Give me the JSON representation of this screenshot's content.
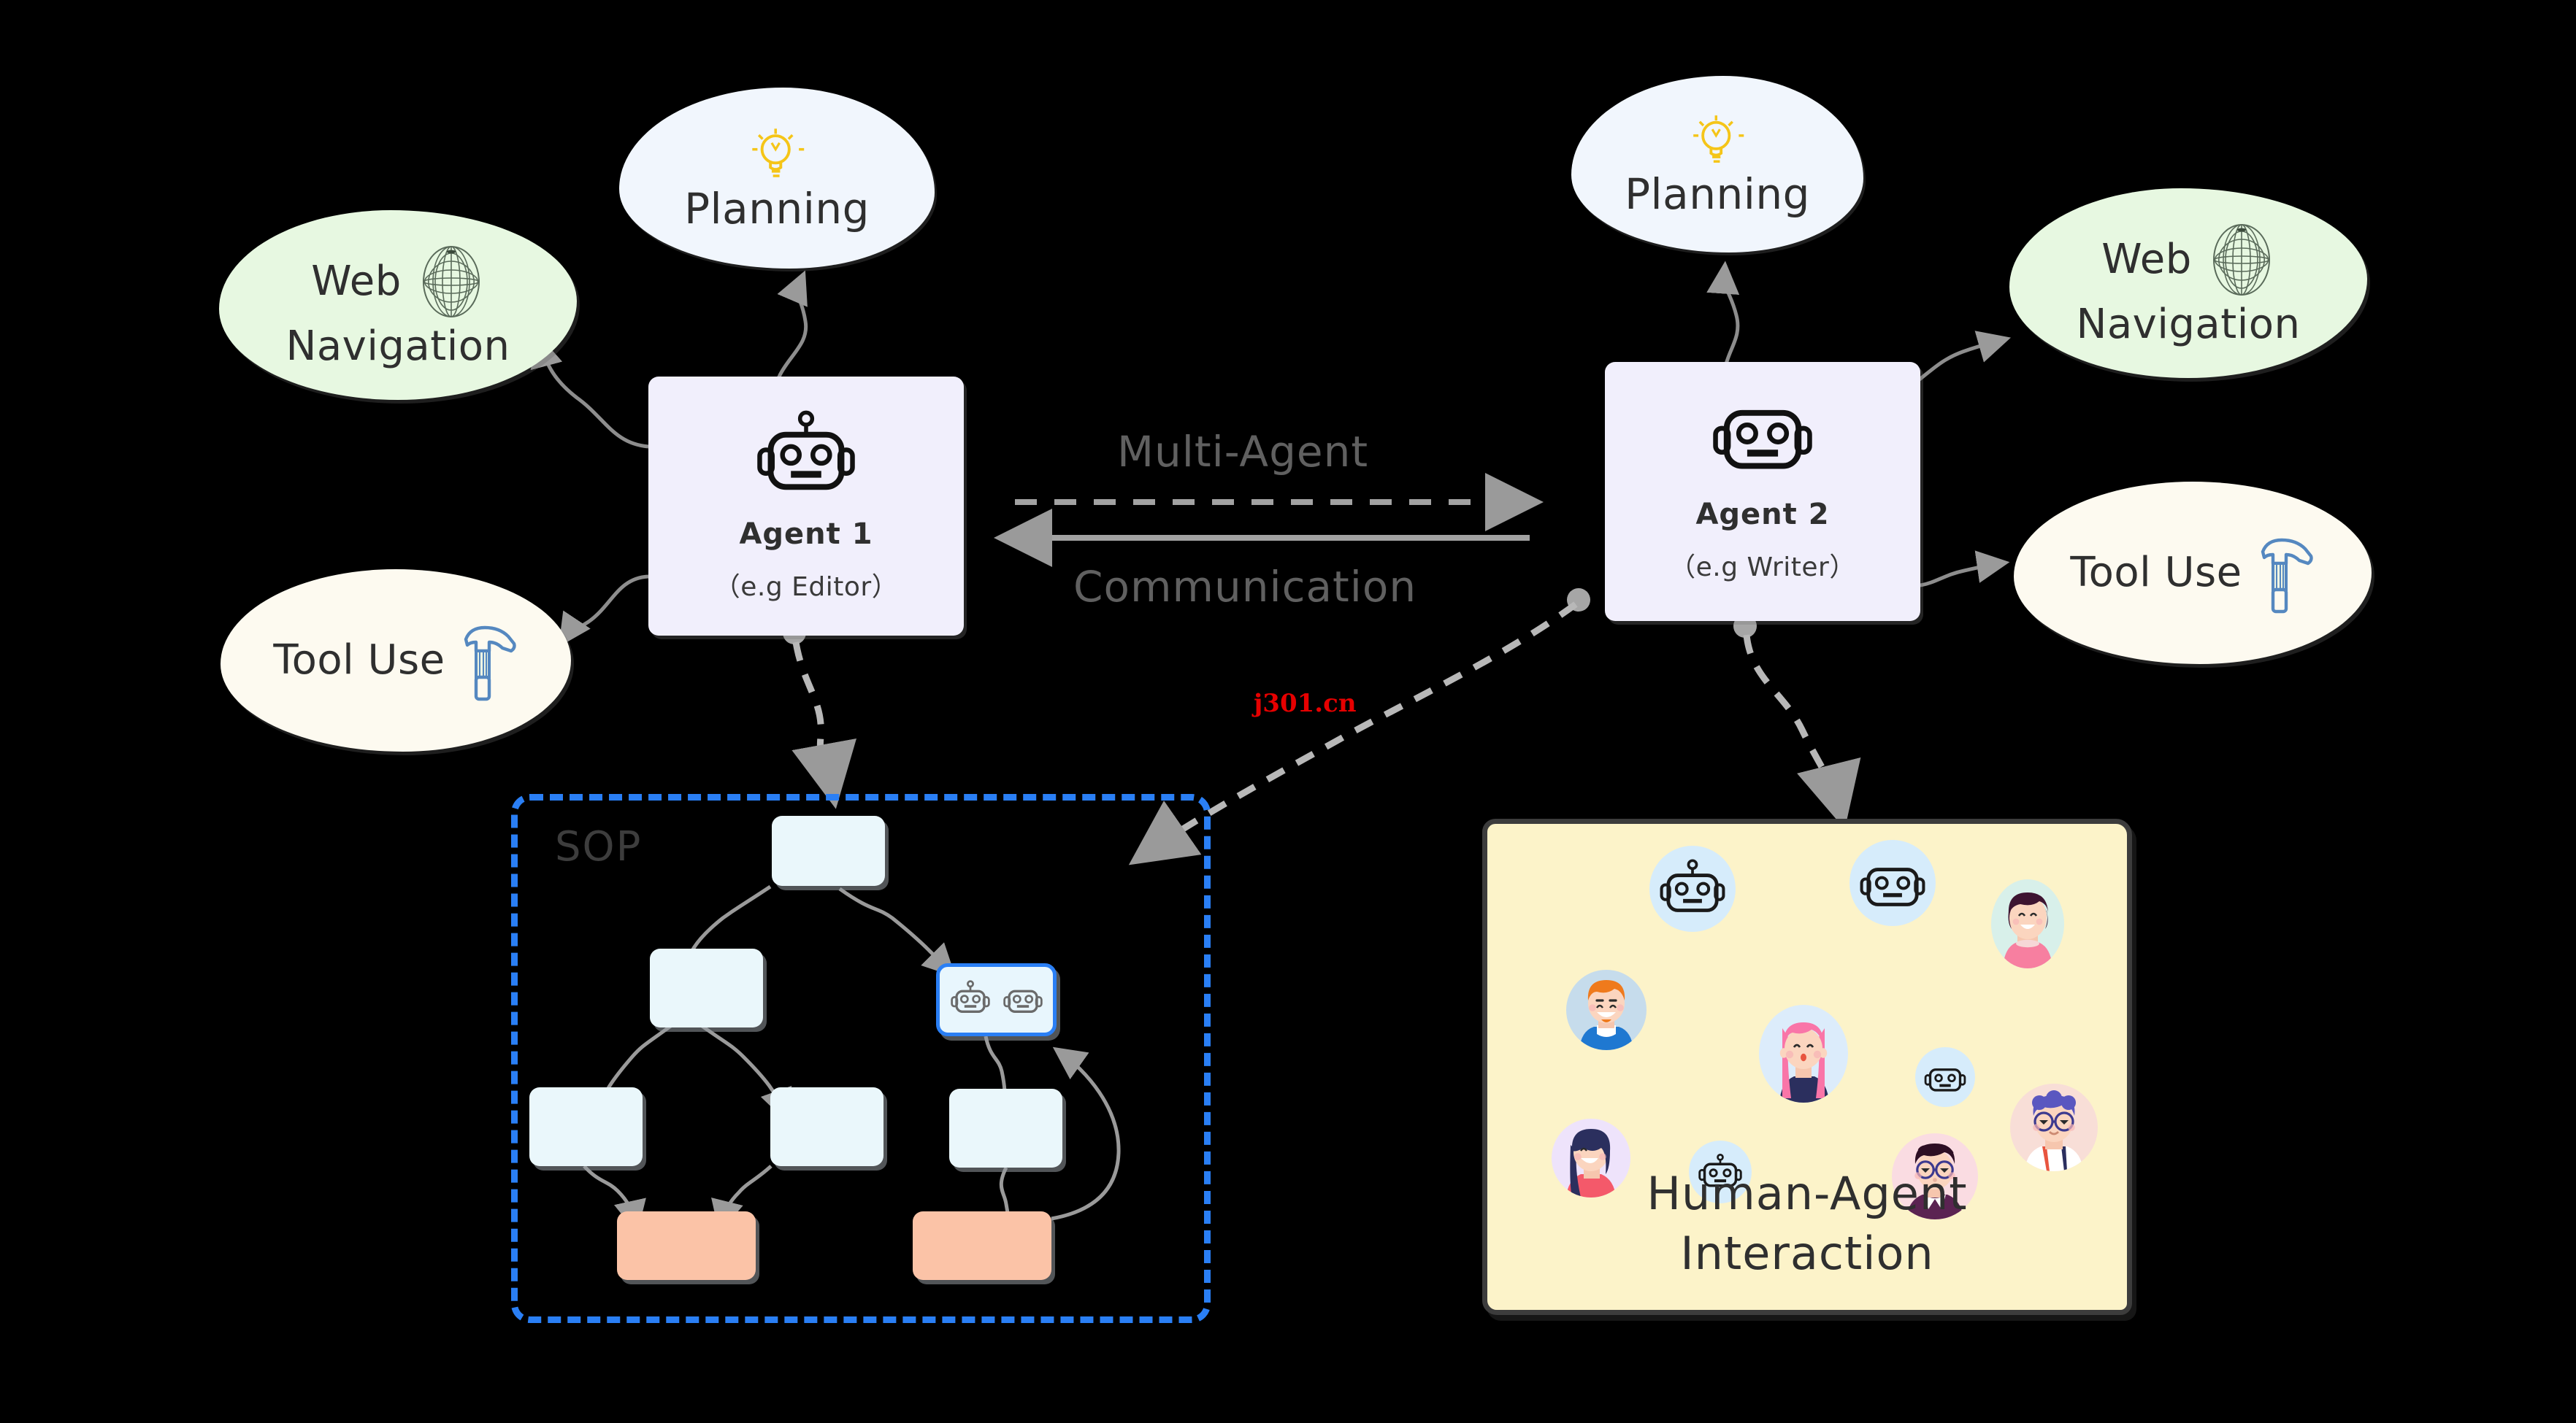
{
  "diagram": {
    "title_watermark": "j301.cn",
    "colors": {
      "agent_card_bg": "#f1effc",
      "planning_bg": "#f1f6fd",
      "web_nav_bg": "#e7f8e1",
      "tool_use_bg": "#fdfaf0",
      "sop_border": "#2a7ff5",
      "flow_node_bg": "#eaf7fb",
      "flow_node_peach": "#fbc3a7",
      "sticky_bg": "#fcf3c9",
      "sticky_border": "#3c3c3c",
      "arrow_gray": "#9a9a9a",
      "lightbulb_yellow": "#f5c518",
      "hammer_blue": "#5588c0",
      "watermark_red": "#e60000"
    }
  },
  "left_agent": {
    "name": "Agent 1",
    "role": "（e.g Editor）",
    "icon": "robot-icon"
  },
  "right_agent": {
    "name": "Agent 2",
    "role": "（e.g Writer）",
    "icon": "robot-icon"
  },
  "capabilities": {
    "planning_left": {
      "label": "Planning",
      "icon": "lightbulb-icon"
    },
    "planning_right": {
      "label": "Planning",
      "icon": "lightbulb-icon"
    },
    "web_nav_left": {
      "line1": "Web",
      "line2": "Navigation",
      "icon": "globe-icon"
    },
    "web_nav_right": {
      "line1": "Web",
      "line2": "Navigation",
      "icon": "globe-icon"
    },
    "tool_use_left": {
      "label": "Tool  Use",
      "icon": "hammer-icon"
    },
    "tool_use_right": {
      "label": "Tool  Use",
      "icon": "hammer-icon"
    }
  },
  "communication": {
    "top_label": "Multi-Agent",
    "bottom_label": "Communication"
  },
  "sop": {
    "label": "SOP",
    "nodes": [
      {
        "id": "root",
        "kind": "plain"
      },
      {
        "id": "l1",
        "kind": "plain"
      },
      {
        "id": "r1",
        "kind": "robots"
      },
      {
        "id": "l2a",
        "kind": "plain"
      },
      {
        "id": "l2b",
        "kind": "plain"
      },
      {
        "id": "r2",
        "kind": "plain"
      },
      {
        "id": "l3",
        "kind": "peach"
      },
      {
        "id": "r3",
        "kind": "peach"
      }
    ]
  },
  "human_agent": {
    "title_line1": "Human-Agent",
    "title_line2": "Interaction",
    "avatars": [
      {
        "id": "robot-1",
        "type": "robot",
        "bg": "#d6ecfb"
      },
      {
        "id": "robot-2",
        "type": "robot",
        "bg": "#d6ecfb"
      },
      {
        "id": "woman-short-hair",
        "type": "human",
        "bg": "#d8f0ea",
        "hair": "#3d1431",
        "shirt": "#f77fa0"
      },
      {
        "id": "man-ginger",
        "type": "human",
        "bg": "#c6dcec",
        "hair": "#ef7a1c",
        "shirt": "#1f78d1"
      },
      {
        "id": "woman-pink-hair",
        "type": "human",
        "bg": "#dcecfb",
        "hair": "#f975a8",
        "shirt": "#2b2f5e"
      },
      {
        "id": "robot-3",
        "type": "robot",
        "bg": "#d6ecfb"
      },
      {
        "id": "man-glasses-blue-hair",
        "type": "human",
        "bg": "#f8ded7",
        "hair": "#5a57c0",
        "shirt": "#ffffff"
      },
      {
        "id": "woman-dark-hair",
        "type": "human",
        "bg": "#eee3fb",
        "hair": "#2b2f5e",
        "shirt": "#f4596a"
      },
      {
        "id": "robot-4",
        "type": "robot",
        "bg": "#d6ecfb"
      },
      {
        "id": "man-glasses-dark-hair",
        "type": "human",
        "bg": "#fadce2",
        "hair": "#2e0f24",
        "shirt": "#5b2352"
      }
    ]
  }
}
